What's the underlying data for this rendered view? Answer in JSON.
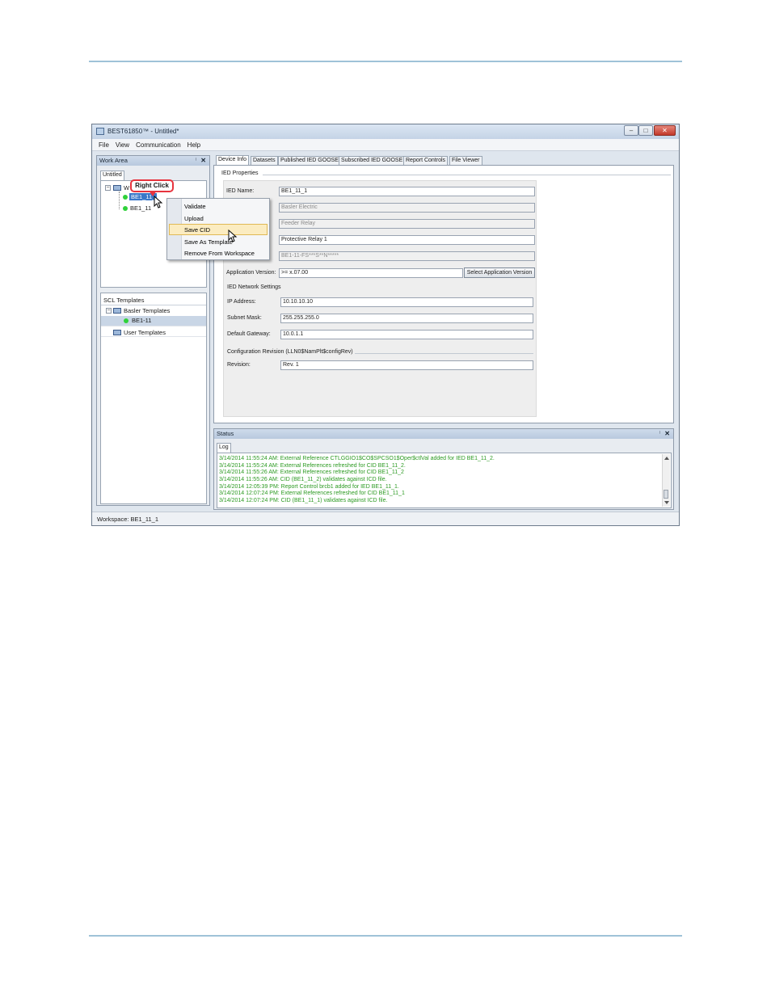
{
  "window": {
    "title": "BEST61850™ - Untitled*",
    "controls": {
      "minimize": "–",
      "maximize": "□",
      "close": "✕"
    }
  },
  "menu": [
    "File",
    "View",
    "Communication",
    "Help"
  ],
  "work_area": {
    "header": "Work Area",
    "pin": "ᛌ",
    "close": "✕",
    "tab": "Untitled",
    "root_label": "W",
    "items": [
      "BE1_11_",
      "BE1_11"
    ]
  },
  "callout": "Right Click",
  "context_menu": {
    "items": [
      "Validate",
      "Upload",
      "Save CID",
      "Save As Template",
      "Remove From Workspace"
    ],
    "highlighted": "Save CID"
  },
  "scl_templates": {
    "header": "SCL Templates",
    "basler": "Basler Templates",
    "basler_child": "BE1-11",
    "user": "User Templates"
  },
  "tabs": [
    "Device Info",
    "Datasets",
    "Published IED GOOSE",
    "Subscribed IED GOOSE",
    "Report Controls",
    "File Viewer"
  ],
  "device": {
    "group_title": "IED Properties",
    "ied_name_label": "IED Name:",
    "ied_name": "BE1_11_1",
    "manufacturer": "Basler Electric",
    "type": "Feeder Relay",
    "description": "Protective Relay 1",
    "style": "BE1-11-FS***S**N*****",
    "app_version_label": "Application Version:",
    "app_version": ">= x.07.00",
    "select_app_button": "Select Application Version",
    "network_title": "IED Network Settings",
    "ip_label": "IP Address:",
    "ip": "10.10.10.10",
    "subnet_label": "Subnet Mask:",
    "subnet": "255.255.255.0",
    "gateway_label": "Default Gateway:",
    "gateway": "10.0.1.1",
    "config_title": "Configuration Revision (LLN0$NamPlt$configRev)",
    "revision_label": "Revision:",
    "revision": "Rev. 1"
  },
  "status": {
    "header": "Status",
    "tab": "Log",
    "lines": [
      "3/14/2014 11:55:24 AM: External Reference CTLGGIO1$CO$SPCSO1$Oper$ctlVal added for IED BE1_11_2.",
      "3/14/2014 11:55:24 AM: External References refreshed for CID BE1_11_2.",
      "3/14/2014 11:55:26 AM: External References refreshed for CID BE1_11_2",
      "3/14/2014 11:55:26 AM: CID (BE1_11_2) validates against ICD file.",
      "3/14/2014 12:05:39 PM: Report Control brcb1 added for IED BE1_11_1.",
      "3/14/2014 12:07:24 PM: External References refreshed for CID BE1_11_1",
      "3/14/2014 12:07:24 PM: CID (BE1_11_1) validates against ICD file."
    ]
  },
  "statusbar": "Workspace: BE1_11_1",
  "colors": {
    "log_text": "#2c9a22",
    "callout_border": "#e7343e",
    "status_dot": "#2fd13a"
  },
  "icons": [
    "app-icon",
    "tree-node-icon",
    "status-dot-icon",
    "mouse-cursor-icon",
    "pin-icon",
    "close-icon"
  ]
}
